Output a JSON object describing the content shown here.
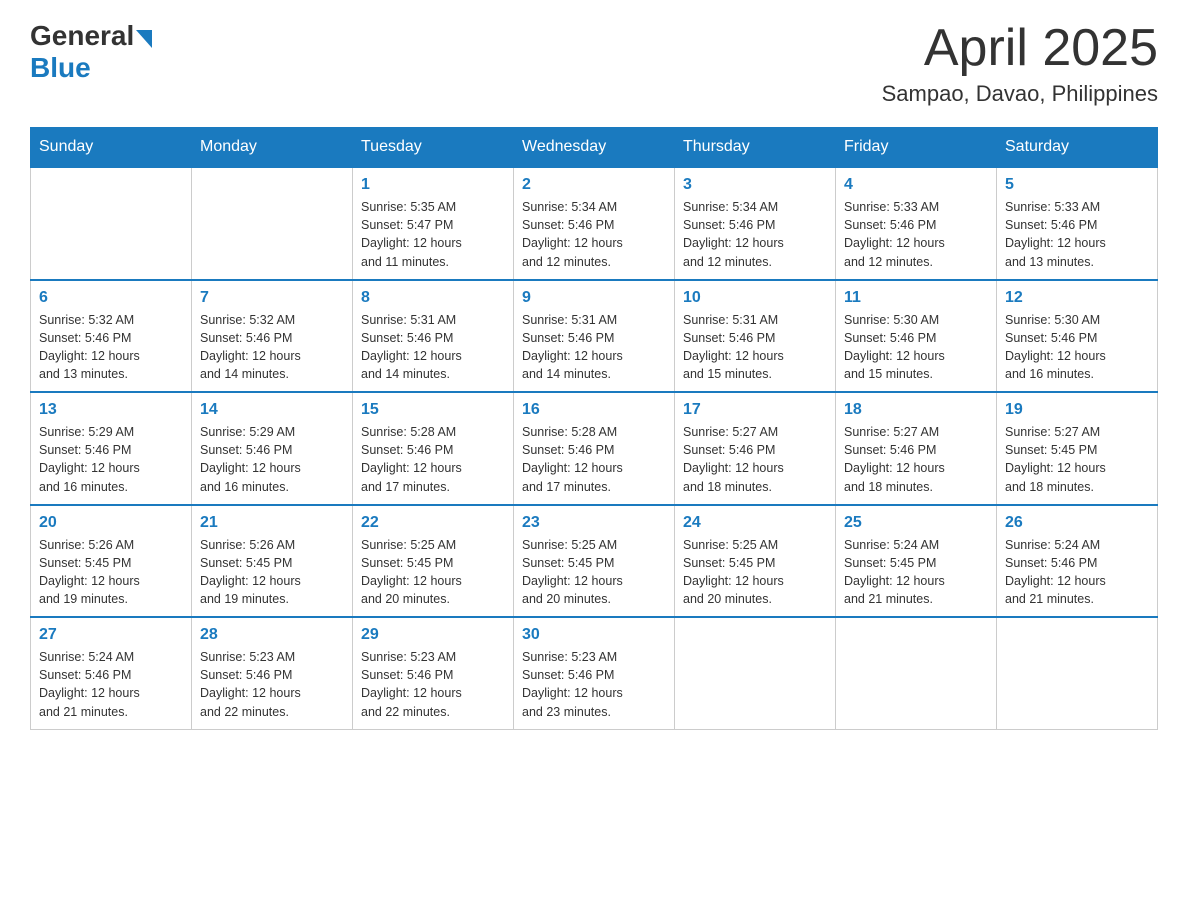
{
  "logo": {
    "general": "General",
    "blue": "Blue"
  },
  "title": {
    "month_year": "April 2025",
    "location": "Sampao, Davao, Philippines"
  },
  "header_days": [
    "Sunday",
    "Monday",
    "Tuesday",
    "Wednesday",
    "Thursday",
    "Friday",
    "Saturday"
  ],
  "weeks": [
    [
      {
        "day": "",
        "info": ""
      },
      {
        "day": "",
        "info": ""
      },
      {
        "day": "1",
        "info": "Sunrise: 5:35 AM\nSunset: 5:47 PM\nDaylight: 12 hours\nand 11 minutes."
      },
      {
        "day": "2",
        "info": "Sunrise: 5:34 AM\nSunset: 5:46 PM\nDaylight: 12 hours\nand 12 minutes."
      },
      {
        "day": "3",
        "info": "Sunrise: 5:34 AM\nSunset: 5:46 PM\nDaylight: 12 hours\nand 12 minutes."
      },
      {
        "day": "4",
        "info": "Sunrise: 5:33 AM\nSunset: 5:46 PM\nDaylight: 12 hours\nand 12 minutes."
      },
      {
        "day": "5",
        "info": "Sunrise: 5:33 AM\nSunset: 5:46 PM\nDaylight: 12 hours\nand 13 minutes."
      }
    ],
    [
      {
        "day": "6",
        "info": "Sunrise: 5:32 AM\nSunset: 5:46 PM\nDaylight: 12 hours\nand 13 minutes."
      },
      {
        "day": "7",
        "info": "Sunrise: 5:32 AM\nSunset: 5:46 PM\nDaylight: 12 hours\nand 14 minutes."
      },
      {
        "day": "8",
        "info": "Sunrise: 5:31 AM\nSunset: 5:46 PM\nDaylight: 12 hours\nand 14 minutes."
      },
      {
        "day": "9",
        "info": "Sunrise: 5:31 AM\nSunset: 5:46 PM\nDaylight: 12 hours\nand 14 minutes."
      },
      {
        "day": "10",
        "info": "Sunrise: 5:31 AM\nSunset: 5:46 PM\nDaylight: 12 hours\nand 15 minutes."
      },
      {
        "day": "11",
        "info": "Sunrise: 5:30 AM\nSunset: 5:46 PM\nDaylight: 12 hours\nand 15 minutes."
      },
      {
        "day": "12",
        "info": "Sunrise: 5:30 AM\nSunset: 5:46 PM\nDaylight: 12 hours\nand 16 minutes."
      }
    ],
    [
      {
        "day": "13",
        "info": "Sunrise: 5:29 AM\nSunset: 5:46 PM\nDaylight: 12 hours\nand 16 minutes."
      },
      {
        "day": "14",
        "info": "Sunrise: 5:29 AM\nSunset: 5:46 PM\nDaylight: 12 hours\nand 16 minutes."
      },
      {
        "day": "15",
        "info": "Sunrise: 5:28 AM\nSunset: 5:46 PM\nDaylight: 12 hours\nand 17 minutes."
      },
      {
        "day": "16",
        "info": "Sunrise: 5:28 AM\nSunset: 5:46 PM\nDaylight: 12 hours\nand 17 minutes."
      },
      {
        "day": "17",
        "info": "Sunrise: 5:27 AM\nSunset: 5:46 PM\nDaylight: 12 hours\nand 18 minutes."
      },
      {
        "day": "18",
        "info": "Sunrise: 5:27 AM\nSunset: 5:46 PM\nDaylight: 12 hours\nand 18 minutes."
      },
      {
        "day": "19",
        "info": "Sunrise: 5:27 AM\nSunset: 5:45 PM\nDaylight: 12 hours\nand 18 minutes."
      }
    ],
    [
      {
        "day": "20",
        "info": "Sunrise: 5:26 AM\nSunset: 5:45 PM\nDaylight: 12 hours\nand 19 minutes."
      },
      {
        "day": "21",
        "info": "Sunrise: 5:26 AM\nSunset: 5:45 PM\nDaylight: 12 hours\nand 19 minutes."
      },
      {
        "day": "22",
        "info": "Sunrise: 5:25 AM\nSunset: 5:45 PM\nDaylight: 12 hours\nand 20 minutes."
      },
      {
        "day": "23",
        "info": "Sunrise: 5:25 AM\nSunset: 5:45 PM\nDaylight: 12 hours\nand 20 minutes."
      },
      {
        "day": "24",
        "info": "Sunrise: 5:25 AM\nSunset: 5:45 PM\nDaylight: 12 hours\nand 20 minutes."
      },
      {
        "day": "25",
        "info": "Sunrise: 5:24 AM\nSunset: 5:45 PM\nDaylight: 12 hours\nand 21 minutes."
      },
      {
        "day": "26",
        "info": "Sunrise: 5:24 AM\nSunset: 5:46 PM\nDaylight: 12 hours\nand 21 minutes."
      }
    ],
    [
      {
        "day": "27",
        "info": "Sunrise: 5:24 AM\nSunset: 5:46 PM\nDaylight: 12 hours\nand 21 minutes."
      },
      {
        "day": "28",
        "info": "Sunrise: 5:23 AM\nSunset: 5:46 PM\nDaylight: 12 hours\nand 22 minutes."
      },
      {
        "day": "29",
        "info": "Sunrise: 5:23 AM\nSunset: 5:46 PM\nDaylight: 12 hours\nand 22 minutes."
      },
      {
        "day": "30",
        "info": "Sunrise: 5:23 AM\nSunset: 5:46 PM\nDaylight: 12 hours\nand 23 minutes."
      },
      {
        "day": "",
        "info": ""
      },
      {
        "day": "",
        "info": ""
      },
      {
        "day": "",
        "info": ""
      }
    ]
  ]
}
